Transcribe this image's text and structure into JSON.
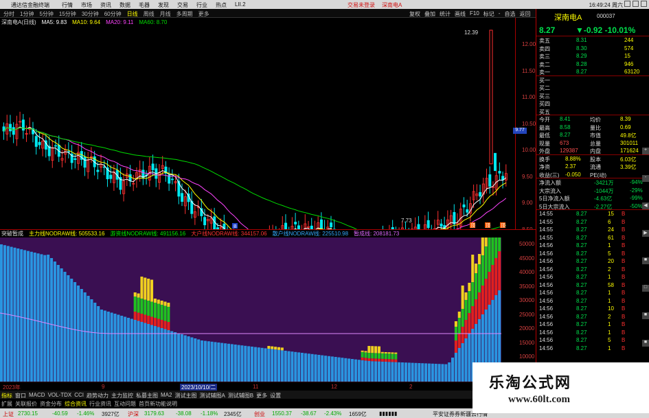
{
  "window": {
    "app_title": "通达信金融终端",
    "menu": [
      "行情",
      "市场",
      "资讯",
      "数据",
      "毛器",
      "发现",
      "交易",
      "行业",
      "热点",
      "LII.2"
    ],
    "promo": [
      "交易未登录",
      "深南电A"
    ],
    "clock": "16:49:24 周六"
  },
  "periods": [
    {
      "label": "分时",
      "active": false
    },
    {
      "label": "1分钟",
      "active": false
    },
    {
      "label": "5分钟",
      "active": false
    },
    {
      "label": "15分钟",
      "active": false
    },
    {
      "label": "30分钟",
      "active": false
    },
    {
      "label": "60分钟",
      "active": false
    },
    {
      "label": "日线",
      "active": true
    },
    {
      "label": "周线",
      "active": false
    },
    {
      "label": "月线",
      "active": false
    },
    {
      "label": "多周期",
      "active": false
    },
    {
      "label": "更多",
      "active": false
    }
  ],
  "right_tools": [
    "复权",
    "叠加",
    "统计",
    "画线",
    "F10",
    "标记",
    "-",
    "自选",
    "返回"
  ],
  "main_chart": {
    "legend": [
      {
        "text": "深南电A(日线)",
        "color": "#dddddd"
      },
      {
        "text": "MA5: 9.83",
        "color": "#ffffff"
      },
      {
        "text": "MA10: 9.64",
        "color": "#ffff00"
      },
      {
        "text": "MA20: 9.11",
        "color": "#ff44ff"
      },
      {
        "text": "MA60: 8.70",
        "color": "#00dd00"
      }
    ],
    "high_label": "12.39",
    "low_label": "7.73",
    "last_price_tag": "9.77",
    "y_ticks": [
      "12.00",
      "11.50",
      "11.00",
      "10.50",
      "10.00",
      "9.50",
      "9.00",
      "8.50",
      "8.00",
      "7.50"
    ],
    "signals": [
      "顶",
      "顶",
      "顶"
    ],
    "buy_signal": "B"
  },
  "indicator": {
    "legend": [
      {
        "text": "突破暂成",
        "color": "#dddddd"
      },
      {
        "text": "主力线NODRAW线: 505533.16",
        "color": "#ffff00"
      },
      {
        "text": "游资线NODRAW线: 491156.16",
        "color": "#00ee00"
      },
      {
        "text": "大户线NODRAW线: 344157.06",
        "color": "#ff3333"
      },
      {
        "text": "散户线NODRAW线: 225510.98",
        "color": "#33aaff"
      },
      {
        "text": "暂成线: 208181.73",
        "color": "#dd66ff"
      }
    ],
    "y_ticks": [
      "50000",
      "45000",
      "40000",
      "35000",
      "30000",
      "25000",
      "20000",
      "15000",
      "10000",
      "5000"
    ]
  },
  "date_axis": {
    "labels": [
      "2023年",
      "9",
      "2023/10/10/二",
      "11",
      "12",
      "2"
    ]
  },
  "tabs": [
    "指标",
    "窗口",
    "MACD",
    "VOL-TDX",
    "CCI",
    "趋势动力",
    "主力监控",
    "私募主图",
    "MA2",
    "测试主图",
    "测试辅图A",
    "测试辅图B",
    "更多",
    "设置"
  ],
  "subtabs": [
    "扩展",
    "关联报价",
    "资金分布",
    "综合资讯",
    "行业资讯",
    "互动问题",
    "首页新功能说明"
  ],
  "status": {
    "sh_label": "上证",
    "sh_value": "2730.15",
    "sh_change": "-40.59",
    "sh_pct": "-1.46%",
    "sh_amount": "3927亿",
    "sz_label": "沪深",
    "sz_value": "3179.63",
    "sz_change": "-38.08",
    "sz_pct": "-1.18%",
    "sz_amount": "2345亿",
    "cy_label": "创业",
    "cy_value": "1550.37",
    "cy_change": "-38.67",
    "cy_pct": "-2.43%",
    "cy_amount": "1659亿",
    "broker": "平安证券券新疆云行情"
  },
  "quote": {
    "stock_name": "深南电A",
    "stock_code": "000037",
    "price": "8.27",
    "change": "▼-0.92",
    "pct": "-10.01%",
    "asks": [
      {
        "label": "卖五",
        "price": "8.31",
        "vol": "244"
      },
      {
        "label": "卖四",
        "price": "8.30",
        "vol": "574"
      },
      {
        "label": "卖三",
        "price": "8.29",
        "vol": "15"
      },
      {
        "label": "卖二",
        "price": "8.28",
        "vol": "946"
      },
      {
        "label": "卖一",
        "price": "8.27",
        "vol": "63120"
      }
    ],
    "bids": [
      {
        "label": "买一",
        "price": "",
        "vol": ""
      },
      {
        "label": "买二",
        "price": "",
        "vol": ""
      },
      {
        "label": "买三",
        "price": "",
        "vol": ""
      },
      {
        "label": "买四",
        "price": "",
        "vol": ""
      },
      {
        "label": "买五",
        "price": "",
        "vol": ""
      }
    ],
    "stats": [
      {
        "l1": "今开",
        "v1": "8.41",
        "l2": "均价",
        "v2": "8.39"
      },
      {
        "l1": "最高",
        "v1": "8.58",
        "l2": "量比",
        "v2": "0.69"
      },
      {
        "l1": "最低",
        "v1": "8.27",
        "l2": "市值",
        "v2": "49.8亿"
      },
      {
        "l1": "现量",
        "v1": "673",
        "l2": "总量",
        "v2": "301011"
      },
      {
        "l1": "外盘",
        "v1": "129387",
        "l2": "内盘",
        "v2": "171624"
      }
    ],
    "stats2": [
      {
        "l1": "换手",
        "v1": "8.88%",
        "l2": "股本",
        "v2": "6.03亿"
      },
      {
        "l1": "净资",
        "v1": "2.37",
        "l2": "流通",
        "v2": "3.39亿"
      },
      {
        "l1": "收益(三)",
        "v1": "-0.050",
        "l2": "PE(动)",
        "v2": ""
      }
    ],
    "flows": [
      {
        "label": "净流入额",
        "value": "-3421万",
        "pct": "-94%"
      },
      {
        "label": "大宗流入",
        "value": "-1044万",
        "pct": "-29%"
      },
      {
        "label": "5日净流入额",
        "value": "-4.63亿",
        "pct": "-99%"
      },
      {
        "label": "5日大宗流入",
        "value": "-2.27亿",
        "pct": "-50%"
      }
    ],
    "ticks": [
      {
        "t": "14:55",
        "p": "8.27",
        "v": "15",
        "d": "B"
      },
      {
        "t": "14:55",
        "p": "8.27",
        "v": "6",
        "d": "B"
      },
      {
        "t": "14:55",
        "p": "8.27",
        "v": "24",
        "d": "B"
      },
      {
        "t": "14:55",
        "p": "8.27",
        "v": "61",
        "d": "B"
      },
      {
        "t": "14:56",
        "p": "8.27",
        "v": "1",
        "d": "B"
      },
      {
        "t": "14:56",
        "p": "8.27",
        "v": "5",
        "d": "B"
      },
      {
        "t": "14:56",
        "p": "8.27",
        "v": "20",
        "d": "B"
      },
      {
        "t": "14:56",
        "p": "8.27",
        "v": "2",
        "d": "B"
      },
      {
        "t": "14:56",
        "p": "8.27",
        "v": "1",
        "d": "B"
      },
      {
        "t": "14:56",
        "p": "8.27",
        "v": "58",
        "d": "B"
      },
      {
        "t": "14:56",
        "p": "8.27",
        "v": "1",
        "d": "B"
      },
      {
        "t": "14:56",
        "p": "8.27",
        "v": "1",
        "d": "B"
      },
      {
        "t": "14:56",
        "p": "8.27",
        "v": "10",
        "d": "B"
      },
      {
        "t": "14:56",
        "p": "8.27",
        "v": "2",
        "d": "B"
      },
      {
        "t": "14:56",
        "p": "8.27",
        "v": "1",
        "d": "B"
      },
      {
        "t": "14:56",
        "p": "8.27",
        "v": "1",
        "d": "B"
      },
      {
        "t": "14:56",
        "p": "8.27",
        "v": "5",
        "d": "B"
      },
      {
        "t": "14:56",
        "p": "8.27",
        "v": "1",
        "d": "B"
      }
    ]
  },
  "watermark": {
    "title": "乐淘公式网",
    "url": "www.60lt.com"
  },
  "side_buttons": [
    "+",
    "-",
    "◀",
    "▶",
    "■",
    "□",
    "■",
    "■"
  ],
  "colors": {
    "up": "#ff3030",
    "down": "#00e8f0",
    "ma5": "#ffffff",
    "ma10": "#ffff00",
    "ma20": "#ff44ff",
    "ma60": "#00dd00",
    "bg_ind": "#3a0f52"
  }
}
